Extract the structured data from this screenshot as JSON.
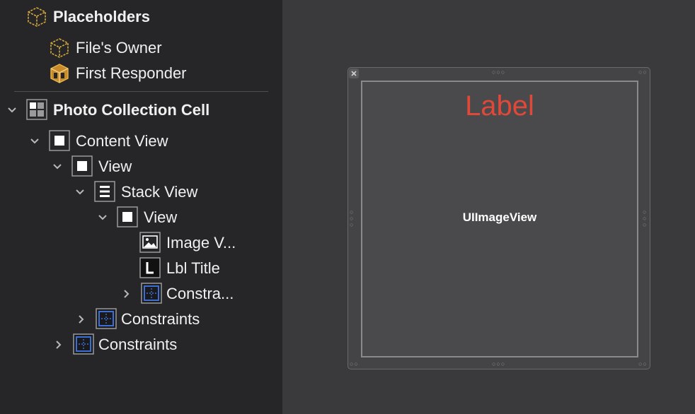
{
  "outline": {
    "placeholders": {
      "title": "Placeholders",
      "files_owner": "File's Owner",
      "first_responder": "First Responder"
    },
    "tree": {
      "photo_collection_cell": "Photo Collection Cell",
      "content_view": "Content View",
      "view": "View",
      "stack_view": "Stack View",
      "inner_view": "View",
      "image_view": "Image V...",
      "lbl_title": "Lbl Title",
      "inner_constraints": "Constra...",
      "view_constraints": "Constraints",
      "content_constraints": "Constraints"
    }
  },
  "canvas": {
    "label_text": "Label",
    "imageview_text": "UIImageView"
  },
  "colors": {
    "label": "#e0483a",
    "constraint_icon": "#3c6fd6",
    "cube_icon": "#d6a93c"
  }
}
